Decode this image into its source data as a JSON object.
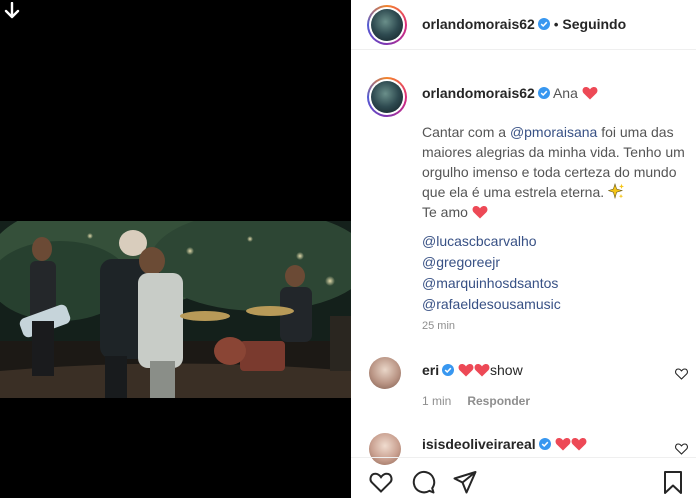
{
  "media": {
    "download_icon": "down-arrow-icon"
  },
  "header": {
    "username": "orlandomorais62",
    "separator": "•",
    "follow_status": "Seguindo"
  },
  "caption": {
    "username": "orlandomorais62",
    "title": "Ana",
    "text_before_mention": "Cantar com a ",
    "mention": "@pmoraisana",
    "text_after_mention": " foi uma das maiores alegrias da minha vida. Tenho um orgulho imenso e toda certeza do mundo que ela é uma estrela eterna.",
    "text_end": "Te amo",
    "tags": [
      "@lucascbcarvalho",
      "@gregoreejr",
      "@marquinhosdsantos",
      "@rafaeldesousamusic"
    ],
    "time_ago": "25 min"
  },
  "comments": [
    {
      "username": "eri",
      "text": "show",
      "time": "1 min",
      "reply_label": "Responder"
    },
    {
      "username": "isisdeoliveirareal",
      "text": ""
    }
  ],
  "colors": {
    "verified": "#3897f0",
    "heart": "#ed4956",
    "link": "#385185",
    "muted": "#8e8e8e"
  },
  "icons": [
    "heart-icon",
    "comment-icon",
    "share-icon",
    "bookmark-icon",
    "more-icon",
    "verified-icon"
  ]
}
